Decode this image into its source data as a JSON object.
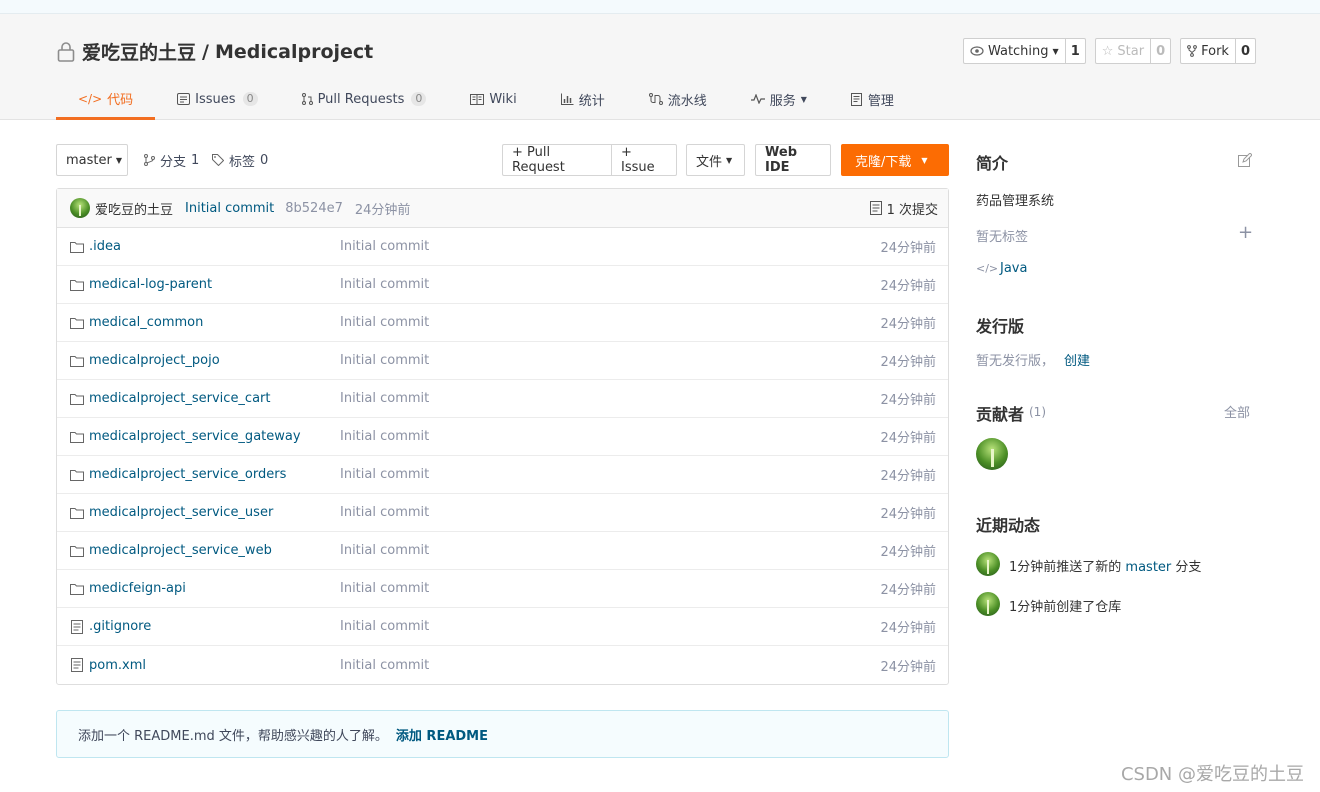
{
  "repo": {
    "owner": "爱吃豆的土豆",
    "separator": "/",
    "name": "Medicalproject"
  },
  "actions": {
    "watch_label": "Watching",
    "watch_count": "1",
    "star_label": "Star",
    "star_count": "0",
    "fork_label": "Fork",
    "fork_count": "0"
  },
  "tabs": [
    {
      "label": "代码"
    },
    {
      "label": "Issues",
      "badge": "0"
    },
    {
      "label": "Pull Requests",
      "badge": "0"
    },
    {
      "label": "Wiki"
    },
    {
      "label": "统计"
    },
    {
      "label": "流水线"
    },
    {
      "label": "服务"
    },
    {
      "label": "管理"
    }
  ],
  "toolbar": {
    "branch": "master",
    "branches_label": "分支",
    "branches_count": "1",
    "tags_label": "标签",
    "tags_count": "0",
    "pull_request": "+ Pull Request",
    "issue": "+ Issue",
    "file": "文件",
    "web_ide": "Web IDE",
    "clone": "克隆/下载"
  },
  "latest_commit": {
    "author": "爱吃豆的土豆",
    "message": "Initial commit",
    "sha": "8b524e7",
    "time": "24分钟前",
    "count_text": "1 次提交"
  },
  "files": [
    {
      "type": "folder",
      "name": ".idea",
      "message": "Initial commit",
      "time": "24分钟前"
    },
    {
      "type": "folder",
      "name": "medical-log-parent",
      "message": "Initial commit",
      "time": "24分钟前"
    },
    {
      "type": "folder",
      "name": "medical_common",
      "message": "Initial commit",
      "time": "24分钟前"
    },
    {
      "type": "folder",
      "name": "medicalproject_pojo",
      "message": "Initial commit",
      "time": "24分钟前"
    },
    {
      "type": "folder",
      "name": "medicalproject_service_cart",
      "message": "Initial commit",
      "time": "24分钟前"
    },
    {
      "type": "folder",
      "name": "medicalproject_service_gateway",
      "message": "Initial commit",
      "time": "24分钟前"
    },
    {
      "type": "folder",
      "name": "medicalproject_service_orders",
      "message": "Initial commit",
      "time": "24分钟前"
    },
    {
      "type": "folder",
      "name": "medicalproject_service_user",
      "message": "Initial commit",
      "time": "24分钟前"
    },
    {
      "type": "folder",
      "name": "medicalproject_service_web",
      "message": "Initial commit",
      "time": "24分钟前"
    },
    {
      "type": "folder",
      "name": "medicfeign-api",
      "message": "Initial commit",
      "time": "24分钟前"
    },
    {
      "type": "file",
      "name": ".gitignore",
      "message": "Initial commit",
      "time": "24分钟前"
    },
    {
      "type": "file",
      "name": "pom.xml",
      "message": "Initial commit",
      "time": "24分钟前"
    }
  ],
  "readme_notice": {
    "text": "添加一个 README.md 文件，帮助感兴趣的人了解。",
    "link": "添加 README"
  },
  "sidebar": {
    "intro_title": "简介",
    "description": "药品管理系统",
    "no_tags": "暂无标签",
    "language": "Java",
    "releases_title": "发行版",
    "no_releases": "暂无发行版，",
    "create_link": "创建",
    "contributors_title": "贡献者",
    "contributors_count": "(1)",
    "all_link": "全部",
    "activity_title": "近期动态",
    "activity": [
      {
        "prefix": "1分钟前推送了新的",
        "branch": "master",
        "suffix": "分支"
      },
      {
        "text": "1分钟前创建了仓库"
      }
    ]
  },
  "watermark": "CSDN @爱吃豆的土豆",
  "colors": {
    "accent": "#f26e21",
    "clone_button": "#fc6c03",
    "link": "#005980"
  }
}
